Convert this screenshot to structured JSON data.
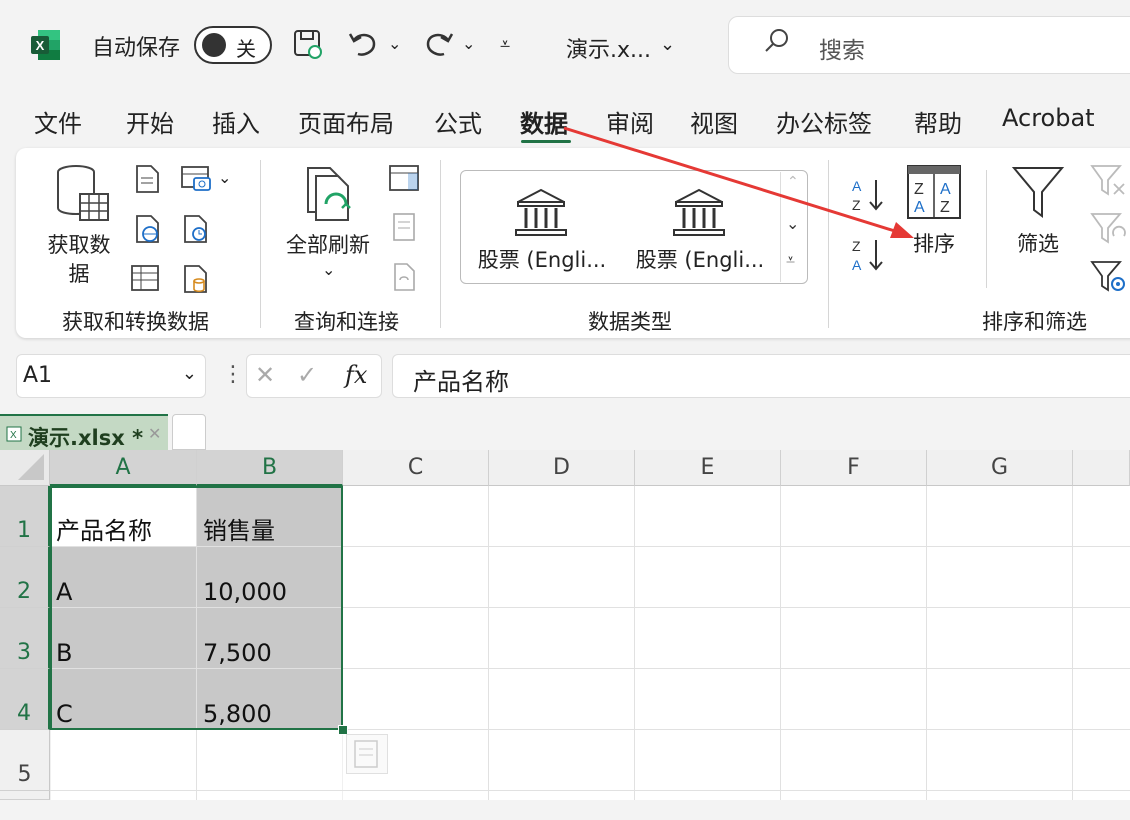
{
  "titlebar": {
    "autosave_label": "自动保存",
    "autosave_state": "关",
    "filename": "演示.x...",
    "search_placeholder": "搜索"
  },
  "menu": {
    "items": [
      "文件",
      "开始",
      "插入",
      "页面布局",
      "公式",
      "数据",
      "审阅",
      "视图",
      "办公标签",
      "帮助",
      "Acrobat"
    ],
    "active": "数据"
  },
  "ribbon": {
    "get_data_label_1": "获取数",
    "get_data_label_2": "据",
    "refresh_label": "全部刷新",
    "stock1": "股票 (Engli...",
    "stock2": "股票 (Engli...",
    "sort_label": "排序",
    "filter_label": "筛选",
    "group_get_transform": "获取和转换数据",
    "group_query": "查询和连接",
    "group_datatypes": "数据类型",
    "group_sort_filter": "排序和筛选"
  },
  "formula_bar": {
    "name_box": "A1",
    "formula": "产品名称",
    "fx": "fx"
  },
  "sheet_tab": {
    "name": "演示.xlsx *"
  },
  "grid": {
    "columns": [
      "A",
      "B",
      "C",
      "D",
      "E",
      "F",
      "G"
    ],
    "rows": [
      "1",
      "2",
      "3",
      "4",
      "5"
    ],
    "cells": [
      [
        "产品名称",
        "销售量"
      ],
      [
        "A",
        "10,000"
      ],
      [
        "B",
        "7,500"
      ],
      [
        "C",
        "5,800"
      ]
    ]
  },
  "colors": {
    "excel_green": "#217346",
    "annotation_arrow": "#e53935"
  }
}
